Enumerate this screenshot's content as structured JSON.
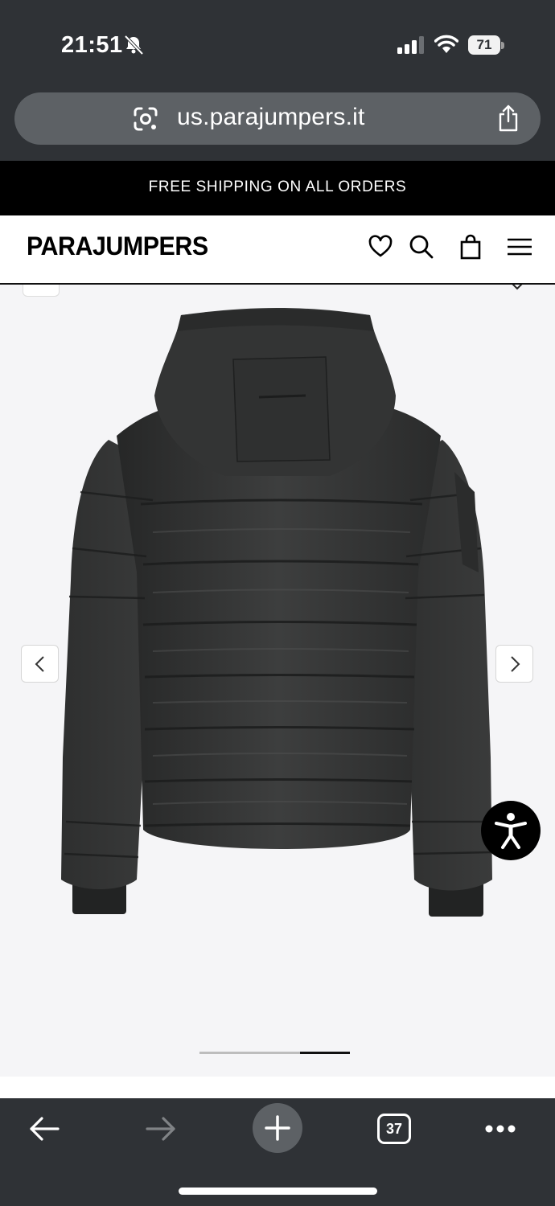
{
  "status_bar": {
    "time": "21:51",
    "battery": "71"
  },
  "browser": {
    "url": "us.parajumpers.it"
  },
  "promo": {
    "text": "FREE SHIPPING ON ALL ORDERS"
  },
  "header": {
    "logo": "PARAJUMPERS"
  },
  "gallery": {
    "image_alt": "Back view of black hooded puffer jacket",
    "progress": 0.33
  },
  "toolbar": {
    "tab_count": "37"
  }
}
